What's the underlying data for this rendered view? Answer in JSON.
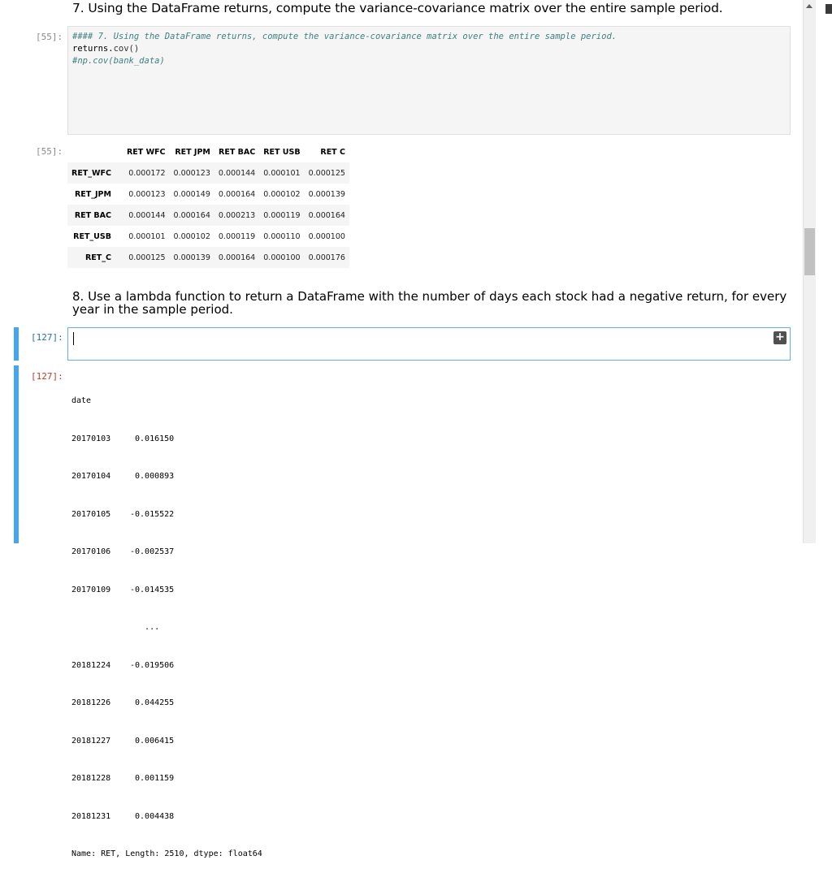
{
  "cell7": {
    "heading": "7. Using the DataFrame returns, compute the variance-covariance matrix over the entire sample period.",
    "in_prompt": "[55]:",
    "code": {
      "line1": "#### 7. Using the DataFrame returns, compute the variance-covariance matrix over the entire sample period.",
      "line2_obj": "returns.",
      "line2_fn": "cov()",
      "line3": "#np.cov(bank_data)"
    },
    "out_prompt": "[55]:",
    "table": {
      "columns": [
        "RET WFC",
        "RET JPM",
        "RET BAC",
        "RET USB",
        "RET C"
      ],
      "rows": [
        {
          "index": "RET_WFC",
          "values": [
            "0.000172",
            "0.000123",
            "0.000144",
            "0.000101",
            "0.000125"
          ]
        },
        {
          "index": "RET_JPM",
          "values": [
            "0.000123",
            "0.000149",
            "0.000164",
            "0.000102",
            "0.000139"
          ]
        },
        {
          "index": "RET BAC",
          "values": [
            "0.000144",
            "0.000164",
            "0.000213",
            "0.000119",
            "0.000164"
          ]
        },
        {
          "index": "RET_USB",
          "values": [
            "0.000101",
            "0.000102",
            "0.000119",
            "0.000110",
            "0.000100"
          ]
        },
        {
          "index": "RET_C",
          "values": [
            "0.000125",
            "0.000139",
            "0.000164",
            "0.000100",
            "0.000176"
          ]
        }
      ]
    }
  },
  "cell8": {
    "heading": "8. Use a lambda function to return a DataFrame with the number of days each stock had a negative return, for every year in the sample period.",
    "in_prompt": "[127]:",
    "out_prompt": "[127]:",
    "add_icon": "plus-icon",
    "output": {
      "header": "date",
      "rows": [
        {
          "k": "20170103",
          "v": " 0.016150"
        },
        {
          "k": "20170104",
          "v": " 0.000893"
        },
        {
          "k": "20170105",
          "v": "-0.015522"
        },
        {
          "k": "20170106",
          "v": "-0.002537"
        },
        {
          "k": "20170109",
          "v": "-0.014535"
        },
        {
          "k": "",
          "v": "   ..."
        },
        {
          "k": "20181224",
          "v": "-0.019506"
        },
        {
          "k": "20181226",
          "v": " 0.044255"
        },
        {
          "k": "20181227",
          "v": " 0.006415"
        },
        {
          "k": "20181228",
          "v": " 0.001159"
        },
        {
          "k": "20181231",
          "v": " 0.004438"
        }
      ],
      "footer": "Name: RET, Length: 2510, dtype: float64"
    }
  },
  "colors": {
    "accent": "#42a5f5",
    "prompt_active": "#1f6fb2",
    "comment": "#408080"
  }
}
